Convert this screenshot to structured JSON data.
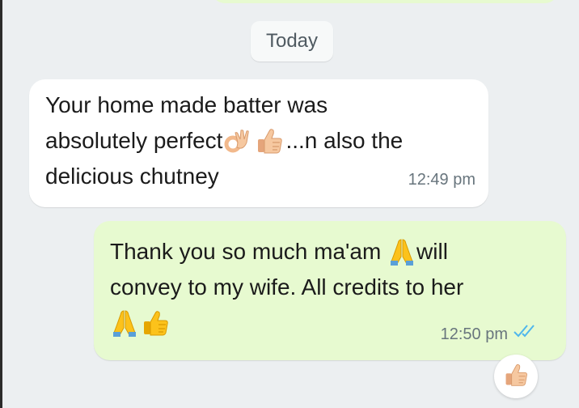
{
  "date_divider": {
    "label": "Today"
  },
  "messages": [
    {
      "direction": "incoming",
      "line1": "Your home made batter was",
      "line2_text": "absolutely perfect",
      "line2_icons": [
        "ok-hand-icon",
        "thumbs-up-icon"
      ],
      "line2_tail": "...n also the",
      "line3": "delicious chutney",
      "time": "12:49 pm"
    },
    {
      "direction": "outgoing",
      "line1_text": "Thank you so much ma'am",
      "line1_icon": "folded-hands-icon",
      "line1_tail": "will",
      "line2": "convey to my wife. All credits to her",
      "line3_icons": [
        "folded-hands-icon",
        "thumbs-up-icon"
      ],
      "time": "12:50 pm",
      "status_icon": "double-check-read-icon",
      "reaction_icon": "thumbs-up-icon"
    }
  ],
  "colors": {
    "chat_background": "#eceff1",
    "incoming_bubble": "#ffffff",
    "outgoing_bubble": "#e7fad0",
    "read_ticks": "#4fb6ec",
    "timestamp": "#68757d"
  }
}
